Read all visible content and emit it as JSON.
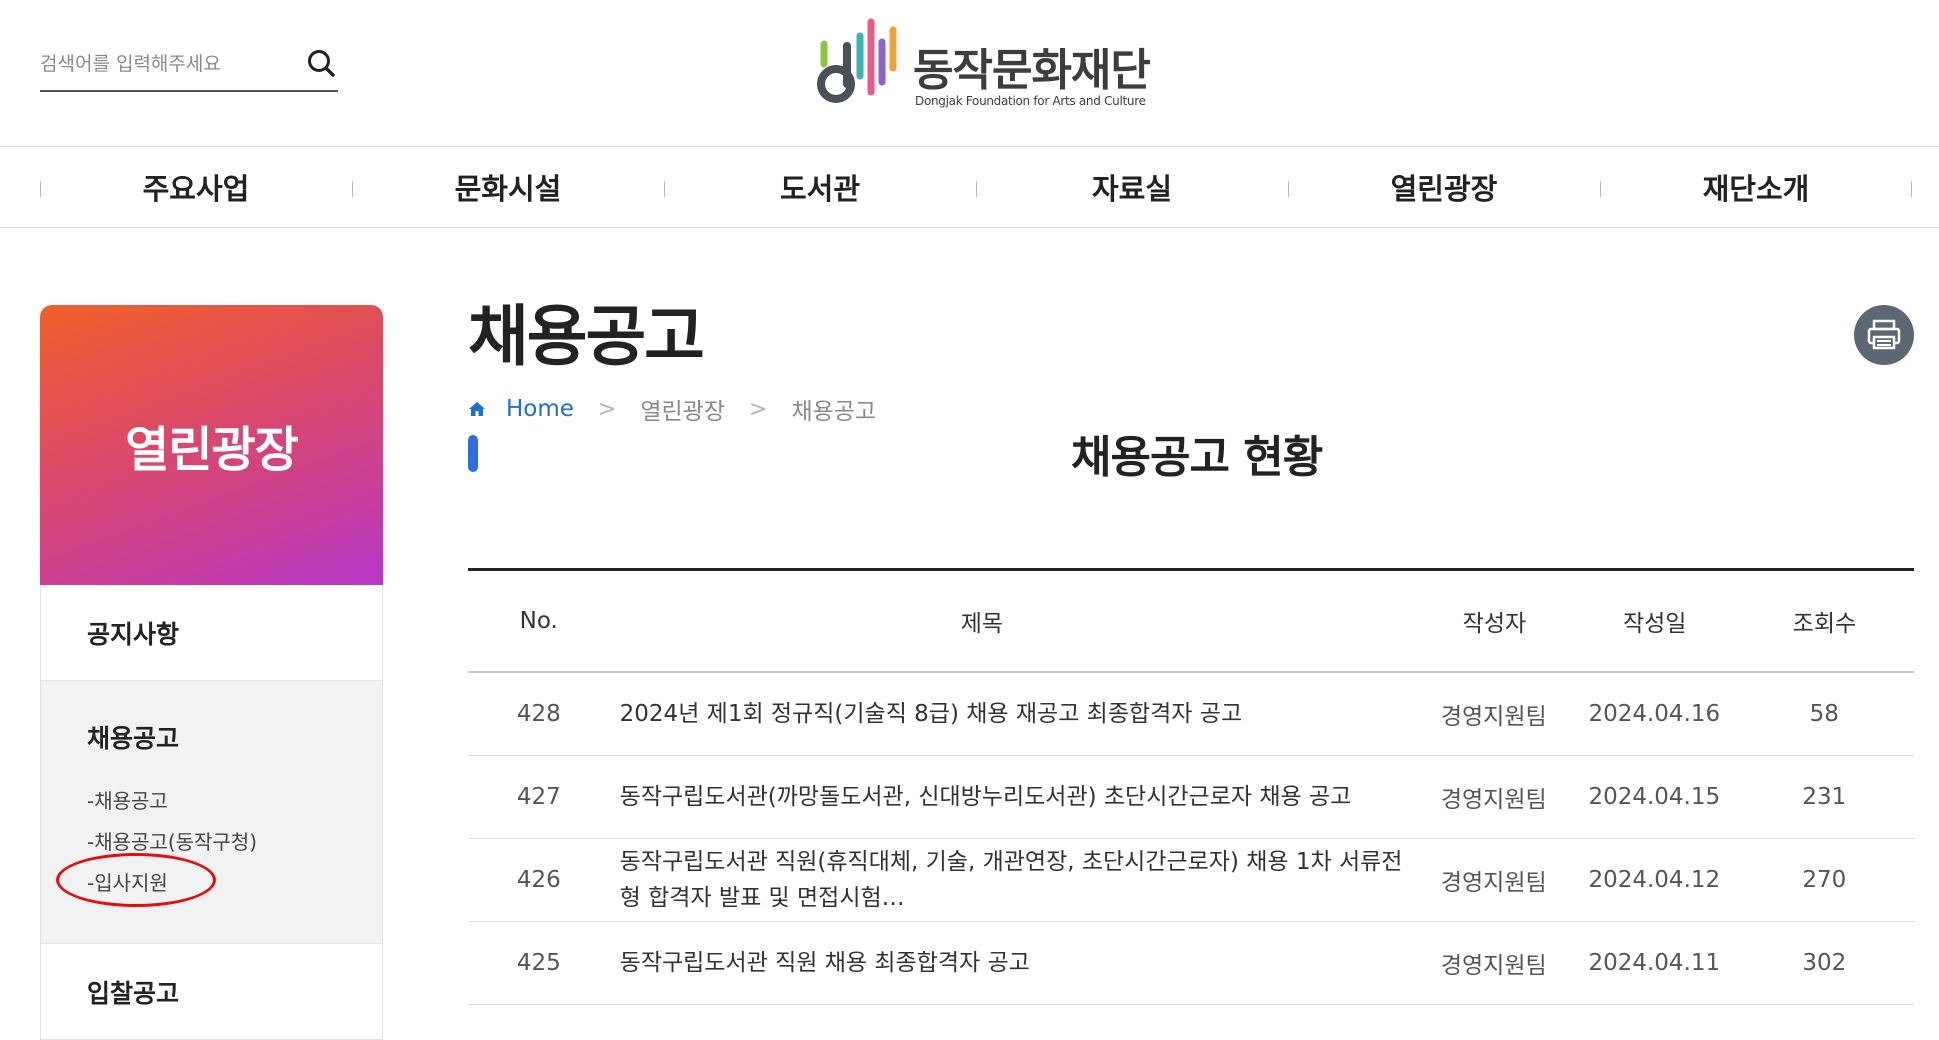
{
  "header": {
    "search_placeholder": "검색어를 입력해주세요",
    "logo_name": "동작문화재단",
    "logo_sub": "Dongjak Foundation for Arts and Culture",
    "icons": {
      "search": "search-icon",
      "logo": "logo-mark-icon"
    }
  },
  "gnb": {
    "items": [
      {
        "label": "주요사업"
      },
      {
        "label": "문화시설"
      },
      {
        "label": "도서관"
      },
      {
        "label": "자료실"
      },
      {
        "label": "열린광장"
      },
      {
        "label": "재단소개"
      }
    ]
  },
  "sidebar": {
    "banner_title": "열린광장",
    "items": [
      {
        "label": "공지사항"
      },
      {
        "label": "채용공고"
      },
      {
        "label": "입찰공고"
      }
    ],
    "sub_items": [
      {
        "label": "-채용공고"
      },
      {
        "label": "-채용공고(동작구청)"
      },
      {
        "label": "-입사지원"
      }
    ],
    "colors": {
      "gradient_start": "#f2602a",
      "gradient_end": "#b437c8"
    }
  },
  "content": {
    "page_title": "채용공고",
    "breadcrumb": {
      "home": "Home",
      "level1": "열린광장",
      "level2": "채용공고",
      "separator": ">"
    },
    "section_title": "채용공고 현황",
    "print_icon": "printer-icon"
  },
  "table": {
    "headers": {
      "no": "No.",
      "title": "제목",
      "writer": "작성자",
      "date": "작성일",
      "views": "조회수"
    },
    "rows": [
      {
        "no": "428",
        "title": "2024년 제1회 정규직(기술직 8급) 채용 재공고 최종합격자 공고",
        "writer": "경영지원팀",
        "date": "2024.04.16",
        "views": "58"
      },
      {
        "no": "427",
        "title": "동작구립도서관(까망돌도서관, 신대방누리도서관) 초단시간근로자 채용 공고",
        "writer": "경영지원팀",
        "date": "2024.04.15",
        "views": "231"
      },
      {
        "no": "426",
        "title": "동작구립도서관 직원(휴직대체, 기술, 개관연장, 초단시간근로자) 채용 1차 서류전형 합격자 발표 및 면접시험…",
        "writer": "경영지원팀",
        "date": "2024.04.12",
        "views": "270"
      },
      {
        "no": "425",
        "title": "동작구립도서관 직원 채용 최종합격자 공고",
        "writer": "경영지원팀",
        "date": "2024.04.11",
        "views": "302"
      }
    ]
  },
  "colors": {
    "accent_blue": "#2f6de0",
    "breadcrumb_home": "#1f6fcf",
    "highlight_circle": "#e01010",
    "print_button": "#5b6772"
  }
}
